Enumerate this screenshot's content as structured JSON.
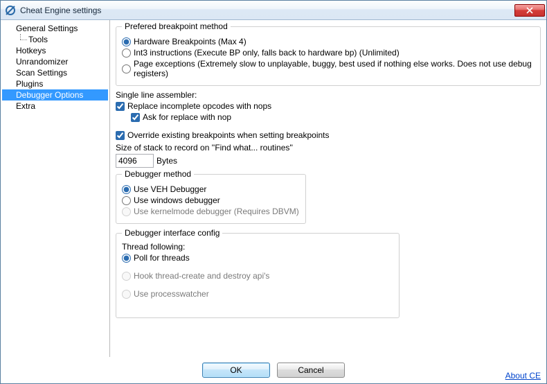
{
  "window": {
    "title": "Cheat Engine settings"
  },
  "sidebar": {
    "items": [
      {
        "label": "General Settings"
      },
      {
        "label": "Tools"
      },
      {
        "label": "Hotkeys"
      },
      {
        "label": "Unrandomizer"
      },
      {
        "label": "Scan Settings"
      },
      {
        "label": "Plugins"
      },
      {
        "label": "Debugger Options"
      },
      {
        "label": "Extra"
      }
    ]
  },
  "bp_method": {
    "legend": "Prefered breakpoint method",
    "hw": "Hardware Breakpoints (Max 4)",
    "int3": "Int3 instructions (Execute BP only, falls back to hardware bp) (Unlimited)",
    "pageex": "Page exceptions (Extremely slow to unplayable, buggy, best used if nothing else works. Does not use debug registers)"
  },
  "assembler": {
    "label": "Single line assembler:",
    "replace_nops": "Replace incomplete opcodes with nops",
    "ask_replace": "Ask for replace with nop"
  },
  "override_bp": "Override existing breakpoints when setting breakpoints",
  "stack": {
    "label": "Size of stack to record on ''Find what... routines''",
    "value": "4096",
    "unit": "Bytes"
  },
  "dbg_method": {
    "legend": "Debugger method",
    "veh": "Use VEH Debugger",
    "win": "Use windows debugger",
    "kern": "Use kernelmode debugger (Requires DBVM)"
  },
  "iface": {
    "legend": "Debugger interface config",
    "thread_following": "Thread following:",
    "poll": "Poll for threads",
    "hook": "Hook thread-create and destroy api's",
    "procwatch": "Use processwatcher"
  },
  "footer": {
    "ok": "OK",
    "cancel": "Cancel",
    "about": "About CE"
  }
}
